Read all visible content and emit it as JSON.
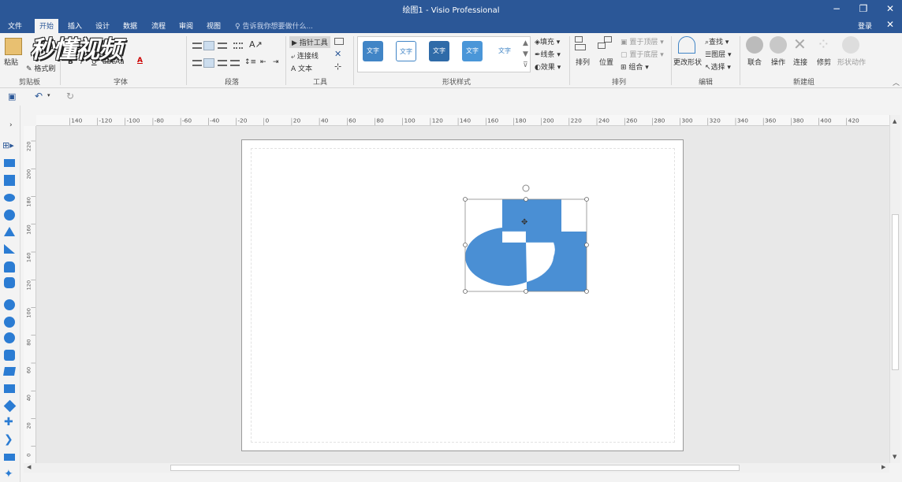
{
  "window": {
    "title": "绘图1 - Visio Professional",
    "minimize": "−",
    "restore": "❐",
    "close": "✕"
  },
  "menu": {
    "items": [
      "文件",
      "开始",
      "插入",
      "设计",
      "数据",
      "流程",
      "审阅",
      "视图"
    ],
    "active_index": 1,
    "tell_me": "告诉我你想要做什么...",
    "login": "登录",
    "close_doc": "✕"
  },
  "ribbon": {
    "clipboard": {
      "label": "剪贴板",
      "paste": "粘贴",
      "format_painter": "格式刷"
    },
    "font": {
      "label": "字体",
      "size_label": "Aa",
      "bold": "B",
      "italic": "I",
      "underline": "U",
      "strike": "abc",
      "font_color": "A"
    },
    "paragraph": {
      "label": "段落"
    },
    "tools": {
      "label": "工具",
      "pointer": "指针工具",
      "connector": "连接线",
      "text": "文本"
    },
    "shape_styles": {
      "label": "形状样式",
      "boxes": [
        "文字",
        "文字",
        "文字",
        "文字",
        "文字"
      ],
      "fill": "填充",
      "line": "线条",
      "effect": "效果"
    },
    "arrange": {
      "label": "排列",
      "arrange": "排列",
      "position": "位置",
      "bring_front": "置于顶层",
      "send_back": "置于底层",
      "group": "组合"
    },
    "edit": {
      "label": "编辑",
      "change_shape": "更改形状",
      "find": "查找",
      "layers": "图层",
      "select": "选择"
    },
    "new_group": {
      "label": "新建组",
      "union": "联合",
      "operate": "操作",
      "connect": "连接",
      "trim": "修剪",
      "shape_anim": "形状动作"
    }
  },
  "watermark": "秒懂视频",
  "rulers": {
    "h_ticks": [
      "140",
      "-120",
      "-100",
      "-80",
      "-60",
      "-40",
      "-20",
      "0",
      "20",
      "40",
      "60",
      "80",
      "100",
      "120",
      "140",
      "160",
      "180",
      "200",
      "220",
      "240",
      "260",
      "280",
      "300",
      "320",
      "340",
      "360",
      "380",
      "400",
      "420"
    ],
    "v_ticks": [
      "220",
      "200",
      "180",
      "160",
      "140",
      "120",
      "100",
      "80",
      "60",
      "40",
      "20",
      "0"
    ]
  },
  "colors": {
    "title_bar": "#2b5797",
    "shape_fill": "#4a8fd4",
    "style_dark": "#4185c6"
  }
}
